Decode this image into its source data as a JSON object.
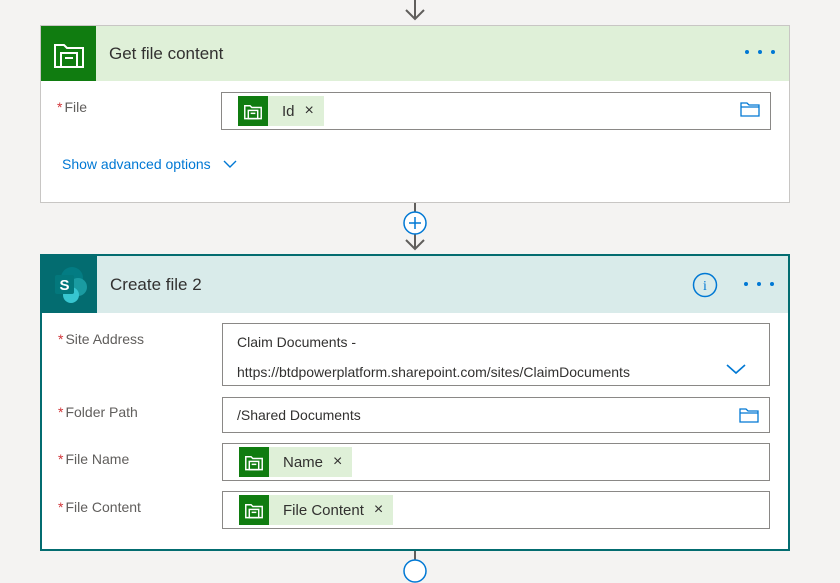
{
  "get_file_content": {
    "title": "Get file content",
    "fields": {
      "file": {
        "label": "File",
        "required_mark": "*",
        "token": "Id",
        "remove": "×"
      }
    },
    "advanced": "Show advanced options"
  },
  "create_file": {
    "title": "Create file 2",
    "logo_letter": "S",
    "info_glyph": "i",
    "fields": {
      "site_address": {
        "label": "Site Address",
        "required_mark": "*",
        "line1": "Claim Documents -",
        "line2": "https://btdpowerplatform.sharepoint.com/sites/ClaimDocuments"
      },
      "folder_path": {
        "label": "Folder Path",
        "required_mark": "*",
        "value": "/Shared Documents"
      },
      "file_name": {
        "label": "File Name",
        "required_mark": "*",
        "token": "Name",
        "remove": "×"
      },
      "file_content": {
        "label": "File Content",
        "required_mark": "*",
        "token": "File Content",
        "remove": "×"
      }
    }
  },
  "colors": {
    "accent": "#0078d4",
    "onedrive_green": "#107c10",
    "sharepoint_teal": "#036c70",
    "header_green_bg": "#dff0d8",
    "header_teal_bg": "#d9ebea"
  },
  "icons": {
    "file_connector": "file-cabinet-icon",
    "sharepoint": "sharepoint-logo-icon",
    "folder": "folder-icon",
    "chevron": "chevron-down-icon",
    "add": "plus-circle-icon",
    "info": "info-icon",
    "more": "more-options-icon"
  }
}
